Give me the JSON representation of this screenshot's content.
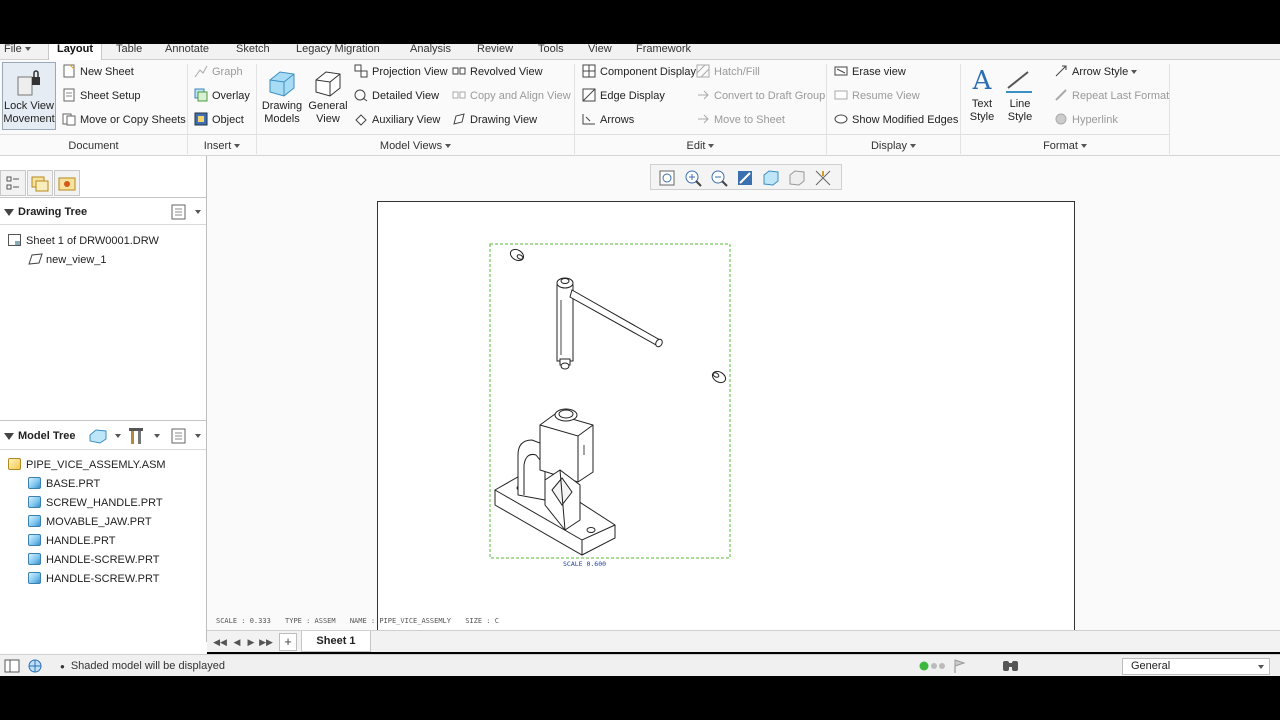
{
  "menubar": {
    "tabs": [
      "File",
      "Layout",
      "Table",
      "Annotate",
      "Sketch",
      "Legacy Migration",
      "Analysis",
      "Review",
      "Tools",
      "View",
      "Framework"
    ],
    "active_tab": "Layout"
  },
  "ribbon": {
    "lock_view_movement": "Lock View Movement",
    "document": {
      "label": "Document",
      "new_sheet": "New Sheet",
      "sheet_setup": "Sheet Setup",
      "move_copy": "Move or Copy Sheets"
    },
    "insert": {
      "label": "Insert",
      "graph": "Graph",
      "overlay": "Overlay",
      "object": "Object"
    },
    "model_views": {
      "label": "Model Views",
      "drawing_models": "Drawing Models",
      "general_view": "General View",
      "projection_view": "Projection View",
      "detailed_view": "Detailed View",
      "auxiliary_view": "Auxiliary View",
      "revolved_view": "Revolved View",
      "copy_align_view": "Copy and Align View",
      "drawing_view": "Drawing View"
    },
    "edit": {
      "label": "Edit",
      "component_display": "Component Display",
      "edge_display": "Edge Display",
      "arrows": "Arrows",
      "hatch_fill": "Hatch/Fill",
      "convert_draft_group": "Convert to Draft Group",
      "move_to_sheet": "Move to Sheet"
    },
    "display": {
      "label": "Display",
      "erase_view": "Erase view",
      "resume_view": "Resume View",
      "show_modified_edges": "Show Modified Edges"
    },
    "format": {
      "label": "Format",
      "text_style": "Text Style",
      "line_style": "Line Style",
      "arrow_style": "Arrow Style",
      "repeat_last_format": "Repeat Last Format",
      "hyperlink": "Hyperlink"
    }
  },
  "drawing_tree": {
    "title": "Drawing Tree",
    "items": [
      "Sheet 1 of DRW0001.DRW",
      "new_view_1"
    ]
  },
  "model_tree": {
    "title": "Model Tree",
    "root": "PIPE_VICE_ASSEMLY.ASM",
    "parts": [
      "BASE.PRT",
      "SCREW_HANDLE.PRT",
      "MOVABLE_JAW.PRT",
      "HANDLE.PRT",
      "HANDLE-SCREW.PRT",
      "HANDLE-SCREW.PRT"
    ]
  },
  "drawing": {
    "view_scale_label": "SCALE  0.600",
    "sheet_info": {
      "scale": "SCALE : 0.333",
      "type": "TYPE : ASSEM",
      "name": "NAME : PIPE_VICE_ASSEMLY",
      "size": "SIZE : C"
    }
  },
  "sheets": {
    "active": "Sheet 1",
    "add": "+"
  },
  "status": {
    "message": "Shaded model will be displayed",
    "filter": "General"
  },
  "colors": {
    "view_border": "#55bb33",
    "ribbon_bg": "#fafafa",
    "sheet_border": "#333333"
  }
}
